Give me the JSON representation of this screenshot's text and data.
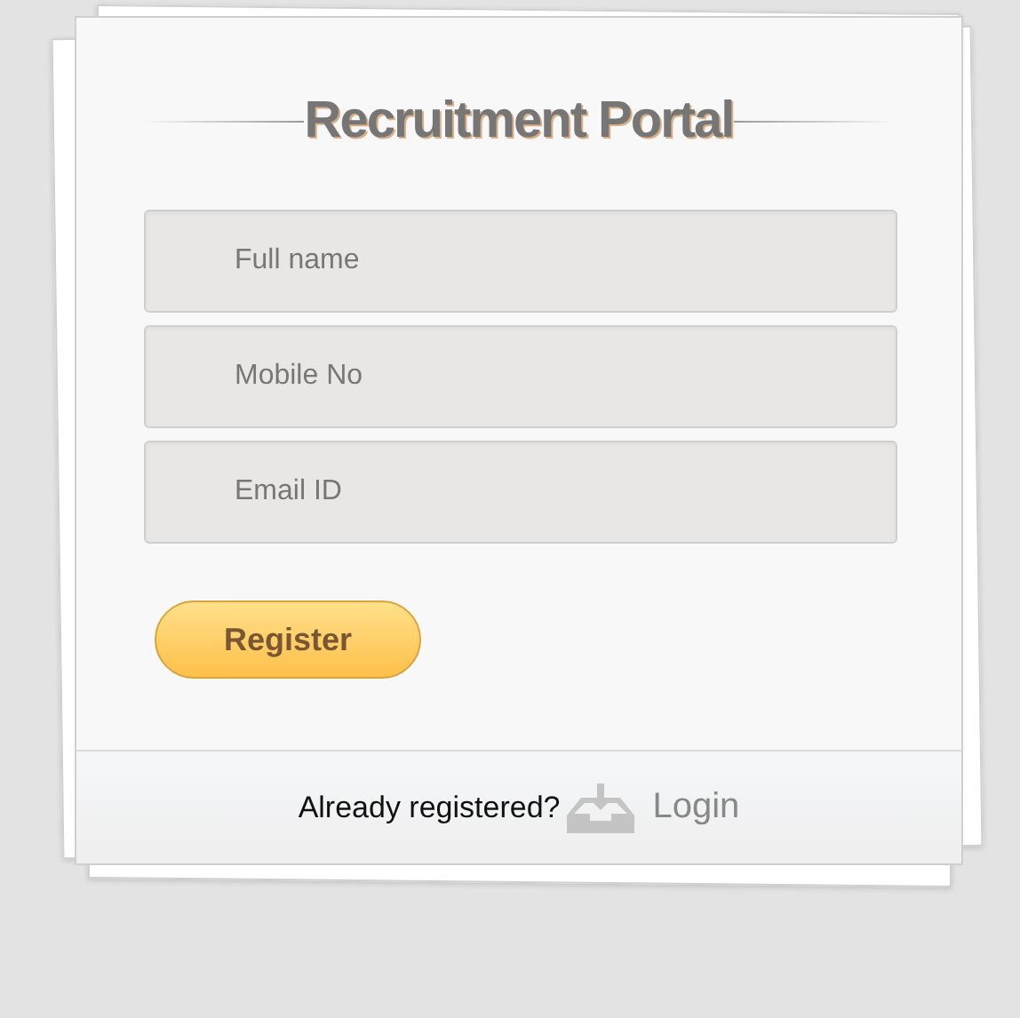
{
  "title": "Recruitment Portal",
  "fields": [
    {
      "placeholder": "Full name"
    },
    {
      "placeholder": "Mobile No"
    },
    {
      "placeholder": "Email ID"
    }
  ],
  "submit_button": "Register",
  "footer": {
    "prompt": "Already registered?",
    "link": "Login"
  }
}
